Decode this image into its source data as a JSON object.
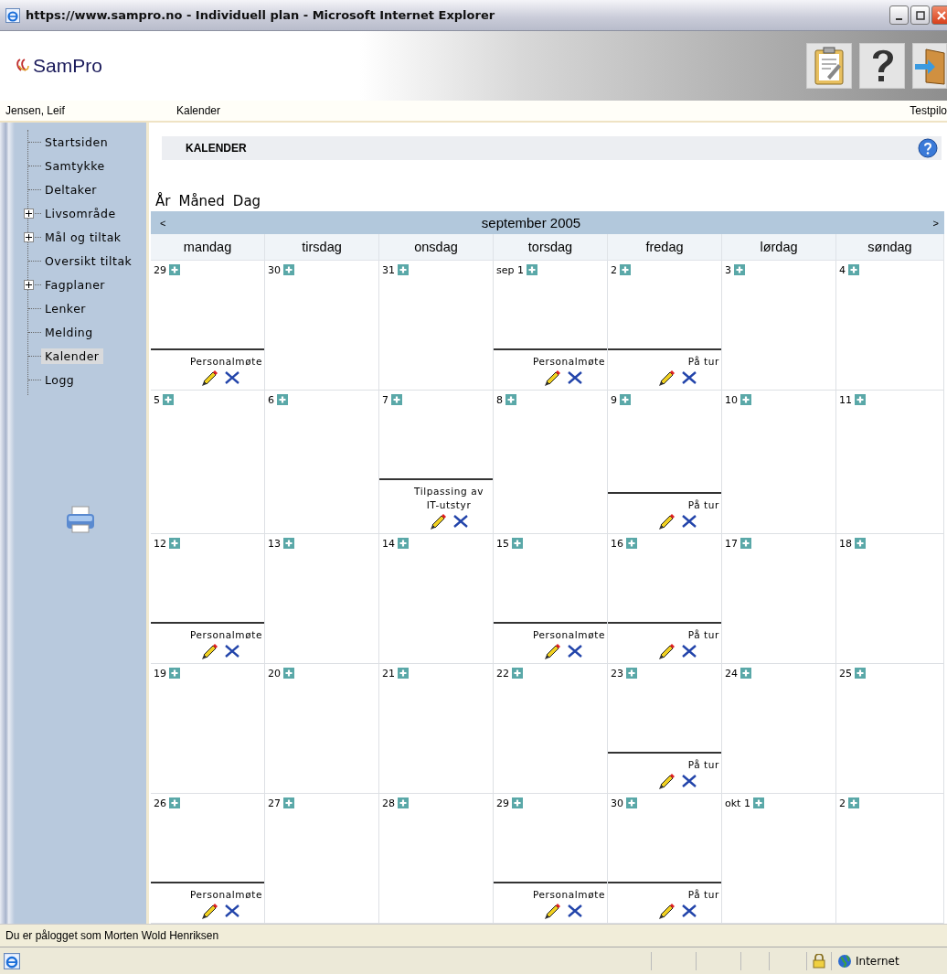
{
  "window": {
    "title": "https://www.sampro.no - Individuell plan - Microsoft Internet Explorer"
  },
  "header": {
    "logo": "SamPro"
  },
  "infobar": {
    "user": "Jensen, Leif",
    "page": "Kalender",
    "right": "Testpilo"
  },
  "sidebar": {
    "items": [
      {
        "label": "Startsiden",
        "expandable": false,
        "selected": false
      },
      {
        "label": "Samtykke",
        "expandable": false,
        "selected": false
      },
      {
        "label": "Deltaker",
        "expandable": false,
        "selected": false
      },
      {
        "label": "Livsområde",
        "expandable": true,
        "selected": false
      },
      {
        "label": "Mål og tiltak",
        "expandable": true,
        "selected": false
      },
      {
        "label": "Oversikt tiltak",
        "expandable": false,
        "selected": false
      },
      {
        "label": "Fagplaner",
        "expandable": true,
        "selected": false
      },
      {
        "label": "Lenker",
        "expandable": false,
        "selected": false
      },
      {
        "label": "Melding",
        "expandable": false,
        "selected": false
      },
      {
        "label": "Kalender",
        "expandable": false,
        "selected": true
      },
      {
        "label": "Logg",
        "expandable": false,
        "selected": false
      }
    ]
  },
  "page_title": "KALENDER",
  "views": [
    "År",
    "Måned",
    "Dag"
  ],
  "calendar": {
    "prev": "<",
    "month": "september 2005",
    "next": ">",
    "weekdays": [
      "mandag",
      "tirsdag",
      "onsdag",
      "torsdag",
      "fredag",
      "lørdag",
      "søndag"
    ],
    "weeks": [
      [
        {
          "day": "29",
          "events": [
            {
              "title": "Personalmøte"
            }
          ]
        },
        {
          "day": "30"
        },
        {
          "day": "31"
        },
        {
          "day": "sep 1",
          "events": [
            {
              "title": "Personalmøte"
            }
          ]
        },
        {
          "day": "2",
          "events": [
            {
              "title": "På tur"
            }
          ]
        },
        {
          "day": "3"
        },
        {
          "day": "4"
        }
      ],
      [
        {
          "day": "5"
        },
        {
          "day": "6"
        },
        {
          "day": "7",
          "events": [
            {
              "title": "Tilpassing av IT-utstyr"
            }
          ]
        },
        {
          "day": "8"
        },
        {
          "day": "9",
          "events": [
            {
              "title": "På tur"
            }
          ]
        },
        {
          "day": "10"
        },
        {
          "day": "11"
        }
      ],
      [
        {
          "day": "12",
          "events": [
            {
              "title": "Personalmøte"
            }
          ]
        },
        {
          "day": "13"
        },
        {
          "day": "14"
        },
        {
          "day": "15",
          "events": [
            {
              "title": "Personalmøte"
            }
          ]
        },
        {
          "day": "16",
          "events": [
            {
              "title": "På tur"
            }
          ]
        },
        {
          "day": "17"
        },
        {
          "day": "18"
        }
      ],
      [
        {
          "day": "19"
        },
        {
          "day": "20"
        },
        {
          "day": "21"
        },
        {
          "day": "22"
        },
        {
          "day": "23",
          "events": [
            {
              "title": "På tur"
            }
          ]
        },
        {
          "day": "24"
        },
        {
          "day": "25"
        }
      ],
      [
        {
          "day": "26",
          "events": [
            {
              "title": "Personalmøte"
            }
          ]
        },
        {
          "day": "27"
        },
        {
          "day": "28"
        },
        {
          "day": "29",
          "events": [
            {
              "title": "Personalmøte"
            }
          ]
        },
        {
          "day": "30",
          "events": [
            {
              "title": "På tur"
            }
          ]
        },
        {
          "day": "okt 1"
        },
        {
          "day": "2"
        }
      ]
    ]
  },
  "footer": "Du er pålogget som Morten Wold Henriksen",
  "status_bar": {
    "zone": "Internet"
  }
}
